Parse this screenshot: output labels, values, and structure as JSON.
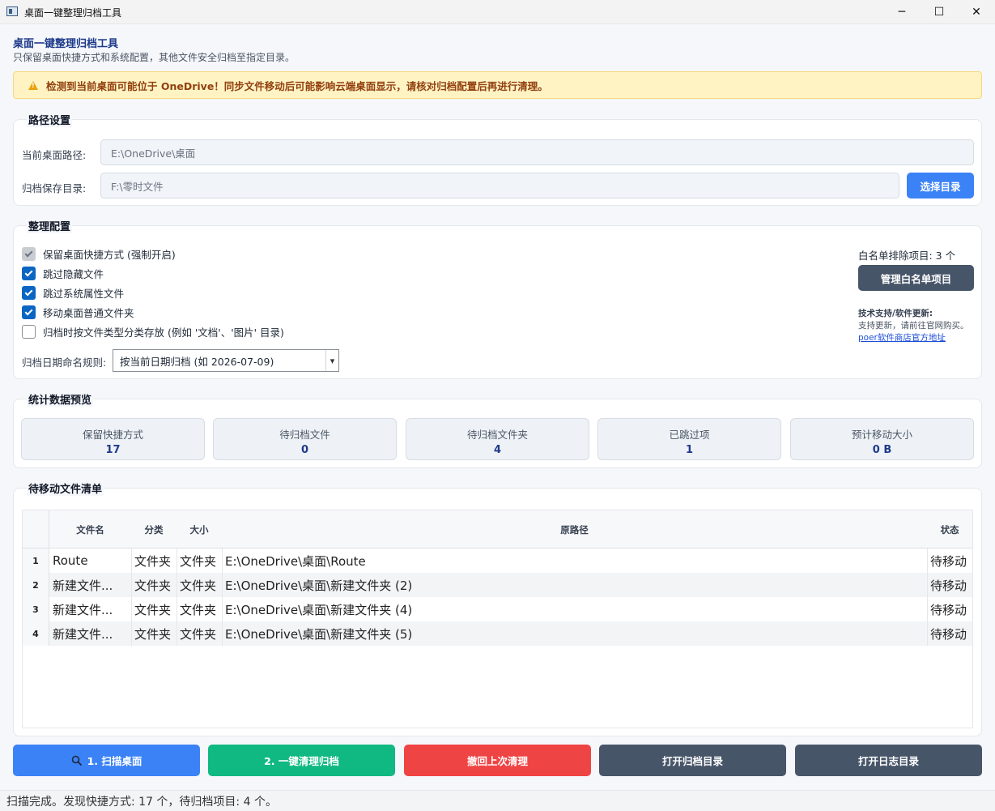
{
  "window": {
    "title": "桌面一键整理归档工具",
    "minimize": "─",
    "maximize": "☐",
    "close": "✕"
  },
  "header": {
    "title": "桌面一键整理归档工具",
    "subtitle": "只保留桌面快捷方式和系统配置，其他文件安全归档至指定目录。"
  },
  "warning": {
    "text": "检测到当前桌面可能位于 OneDrive！同步文件移动后可能影响云端桌面显示，请核对归档配置后再进行清理。"
  },
  "paths": {
    "title": "路径设置",
    "desktop_label": "当前桌面路径:",
    "desktop_value": "E:\\OneDrive\\桌面",
    "archive_label": "归档保存目录:",
    "archive_value": "F:\\零时文件",
    "choose_button": "选择目录"
  },
  "config": {
    "title": "整理配置",
    "options": [
      {
        "label": "保留桌面快捷方式 (强制开启)",
        "state": "disabled-checked"
      },
      {
        "label": "跳过隐藏文件",
        "state": "checked"
      },
      {
        "label": "跳过系统属性文件",
        "state": "checked"
      },
      {
        "label": "移动桌面普通文件夹",
        "state": "checked"
      },
      {
        "label": "归档时按文件类型分类存放 (例如 '文档'、'图片' 目录)",
        "state": "unchecked"
      }
    ],
    "date_rule_label": "归档日期命名规则:",
    "date_rule_value": "按当前日期归档 (如 2026-07-09)",
    "whitelist_count": "白名单排除项目: 3 个",
    "whitelist_button": "管理白名单项目",
    "support_title": "技术支持/软件更新:",
    "support_text": "支持更新，请前往官网购买。",
    "support_link": "poer软件商店官方地址"
  },
  "stats": {
    "title": "统计数据预览",
    "items": [
      {
        "label": "保留快捷方式",
        "value": "17"
      },
      {
        "label": "待归档文件",
        "value": "0"
      },
      {
        "label": "待归档文件夹",
        "value": "4"
      },
      {
        "label": "已跳过项",
        "value": "1"
      },
      {
        "label": "预计移动大小",
        "value": "0 B"
      }
    ]
  },
  "filelist": {
    "title": "待移动文件清单",
    "columns": {
      "name": "文件名",
      "type": "分类",
      "size": "大小",
      "path": "原路径",
      "status": "状态"
    },
    "rows": [
      {
        "num": "1",
        "name": "Route",
        "type": "文件夹",
        "size": "文件夹",
        "path": "E:\\OneDrive\\桌面\\Route",
        "status": "待移动"
      },
      {
        "num": "2",
        "name": "新建文件...",
        "type": "文件夹",
        "size": "文件夹",
        "path": "E:\\OneDrive\\桌面\\新建文件夹 (2)",
        "status": "待移动"
      },
      {
        "num": "3",
        "name": "新建文件...",
        "type": "文件夹",
        "size": "文件夹",
        "path": "E:\\OneDrive\\桌面\\新建文件夹 (4)",
        "status": "待移动"
      },
      {
        "num": "4",
        "name": "新建文件...",
        "type": "文件夹",
        "size": "文件夹",
        "path": "E:\\OneDrive\\桌面\\新建文件夹 (5)",
        "status": "待移动"
      }
    ]
  },
  "actions": {
    "scan": "1. 扫描桌面",
    "clean": "2. 一键清理归档",
    "undo": "撤回上次清理",
    "open_archive": "打开归档目录",
    "open_log": "打开日志目录"
  },
  "status": {
    "text": "扫描完成。发现快捷方式: 17 个，待归档项目: 4 个。"
  },
  "colors": {
    "accent": "#3b82f6",
    "clean": "#10b981",
    "undo": "#ef4444",
    "dark": "#475569",
    "title": "#1e3a8a",
    "warning_bg": "#fff3c4"
  }
}
